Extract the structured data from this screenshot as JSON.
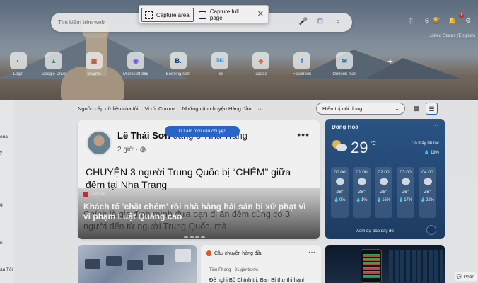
{
  "search": {
    "placeholder": "Tìm kiếm trên web"
  },
  "capture": {
    "area_label": "Capture area",
    "full_label": "Capture full page"
  },
  "top_right": {
    "points": "6",
    "locale": "United States (English)",
    "notif_count": "1"
  },
  "quick_links": [
    {
      "label": "Login",
      "glyph": "◐",
      "color": "#3a7bd5"
    },
    {
      "label": "Google Drive",
      "glyph": "▲",
      "color": "#1fa463"
    },
    {
      "label": "chaptei",
      "glyph": "▦",
      "color": "#d9534f"
    },
    {
      "label": "Microsoft 365",
      "glyph": "◉",
      "color": "#7a5af8"
    },
    {
      "label": "Booking.com",
      "glyph": "B.",
      "color": "#003580"
    },
    {
      "label": "Tiki",
      "glyph": "TIKI",
      "color": "#1a94ff"
    },
    {
      "label": "lazada",
      "glyph": "◆",
      "color": "#f57224"
    },
    {
      "label": "Facebook",
      "glyph": "f",
      "color": "#1877f2"
    },
    {
      "label": "Outlook mail",
      "glyph": "✉",
      "color": "#0a64ad"
    }
  ],
  "left_column": [
    "ona",
    "ý",
    "g",
    "n",
    "âu Tôi"
  ],
  "tabs": [
    "Nguồn cấp dữ liệu của tôi",
    "Vi rút Corona",
    "Những câu chuyện Hàng đầu",
    "···"
  ],
  "display_select": {
    "value": "Hiển thị nội dung"
  },
  "main_card": {
    "author": "Lê Thái Sơn",
    "author_suffix": "đang ở Nha Trang",
    "time": "2 giờ ·",
    "headline": "CHUYỆN 3 người Trung Quốc bị “CHÉM” giữa đêm tại Nha Trang",
    "source": "Tuổi trẻ",
    "title2": "Khách tố 'chặt chém' rồi nhà hàng hải sản bị xử phạt vì vi phạm Luật Quảng cáo",
    "ghost_text": "Chính là gia đình mình đưa bạn đi ăn đêm cùng có 3 người đến từ người Trung Quốc, mà"
  },
  "refresh_label": "Làm mới câu chuyện",
  "weather": {
    "location": "Đông Hòa",
    "temp": "29",
    "unit": "°C",
    "condition": "Có mây rải rác",
    "rain": "19%",
    "hours": [
      {
        "time": "00:00",
        "temp": "28°",
        "precip": "0%"
      },
      {
        "time": "01:00",
        "temp": "28°",
        "precip": "1%"
      },
      {
        "time": "02:00",
        "temp": "28°",
        "precip": "16%"
      },
      {
        "time": "03:00",
        "temp": "28°",
        "precip": "17%"
      },
      {
        "time": "04:00",
        "temp": "28°",
        "precip": "22%"
      }
    ],
    "see_more": "Xem dự báo đầy đủ"
  },
  "lower": {
    "top_stories": "Câu chuyện hàng đầu",
    "source": "Tiền Phong · 21 giờ trước",
    "title": "Đề nghị Bộ Chính trị, Ban Bí thư thi hành"
  },
  "feedback": "Phản"
}
